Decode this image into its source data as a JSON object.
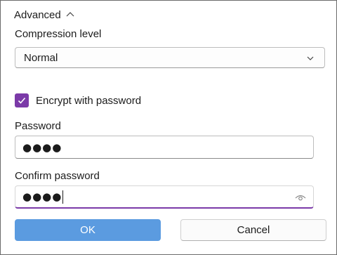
{
  "advanced": {
    "label": "Advanced",
    "icon": "chevron-up-icon",
    "expanded": true
  },
  "compression": {
    "label": "Compression level",
    "selected": "Normal",
    "icon": "chevron-down-icon"
  },
  "encrypt": {
    "label": "Encrypt with password",
    "checked": true,
    "icon": "checkmark-icon"
  },
  "password": {
    "label": "Password",
    "masked_value": "●●●●"
  },
  "confirm_password": {
    "label": "Confirm password",
    "masked_value": "●●●●",
    "reveal_icon": "eye-icon"
  },
  "buttons": {
    "ok": "OK",
    "cancel": "Cancel"
  },
  "colors": {
    "accent": "#7b3aa8",
    "primary_button": "#5b9be0"
  }
}
